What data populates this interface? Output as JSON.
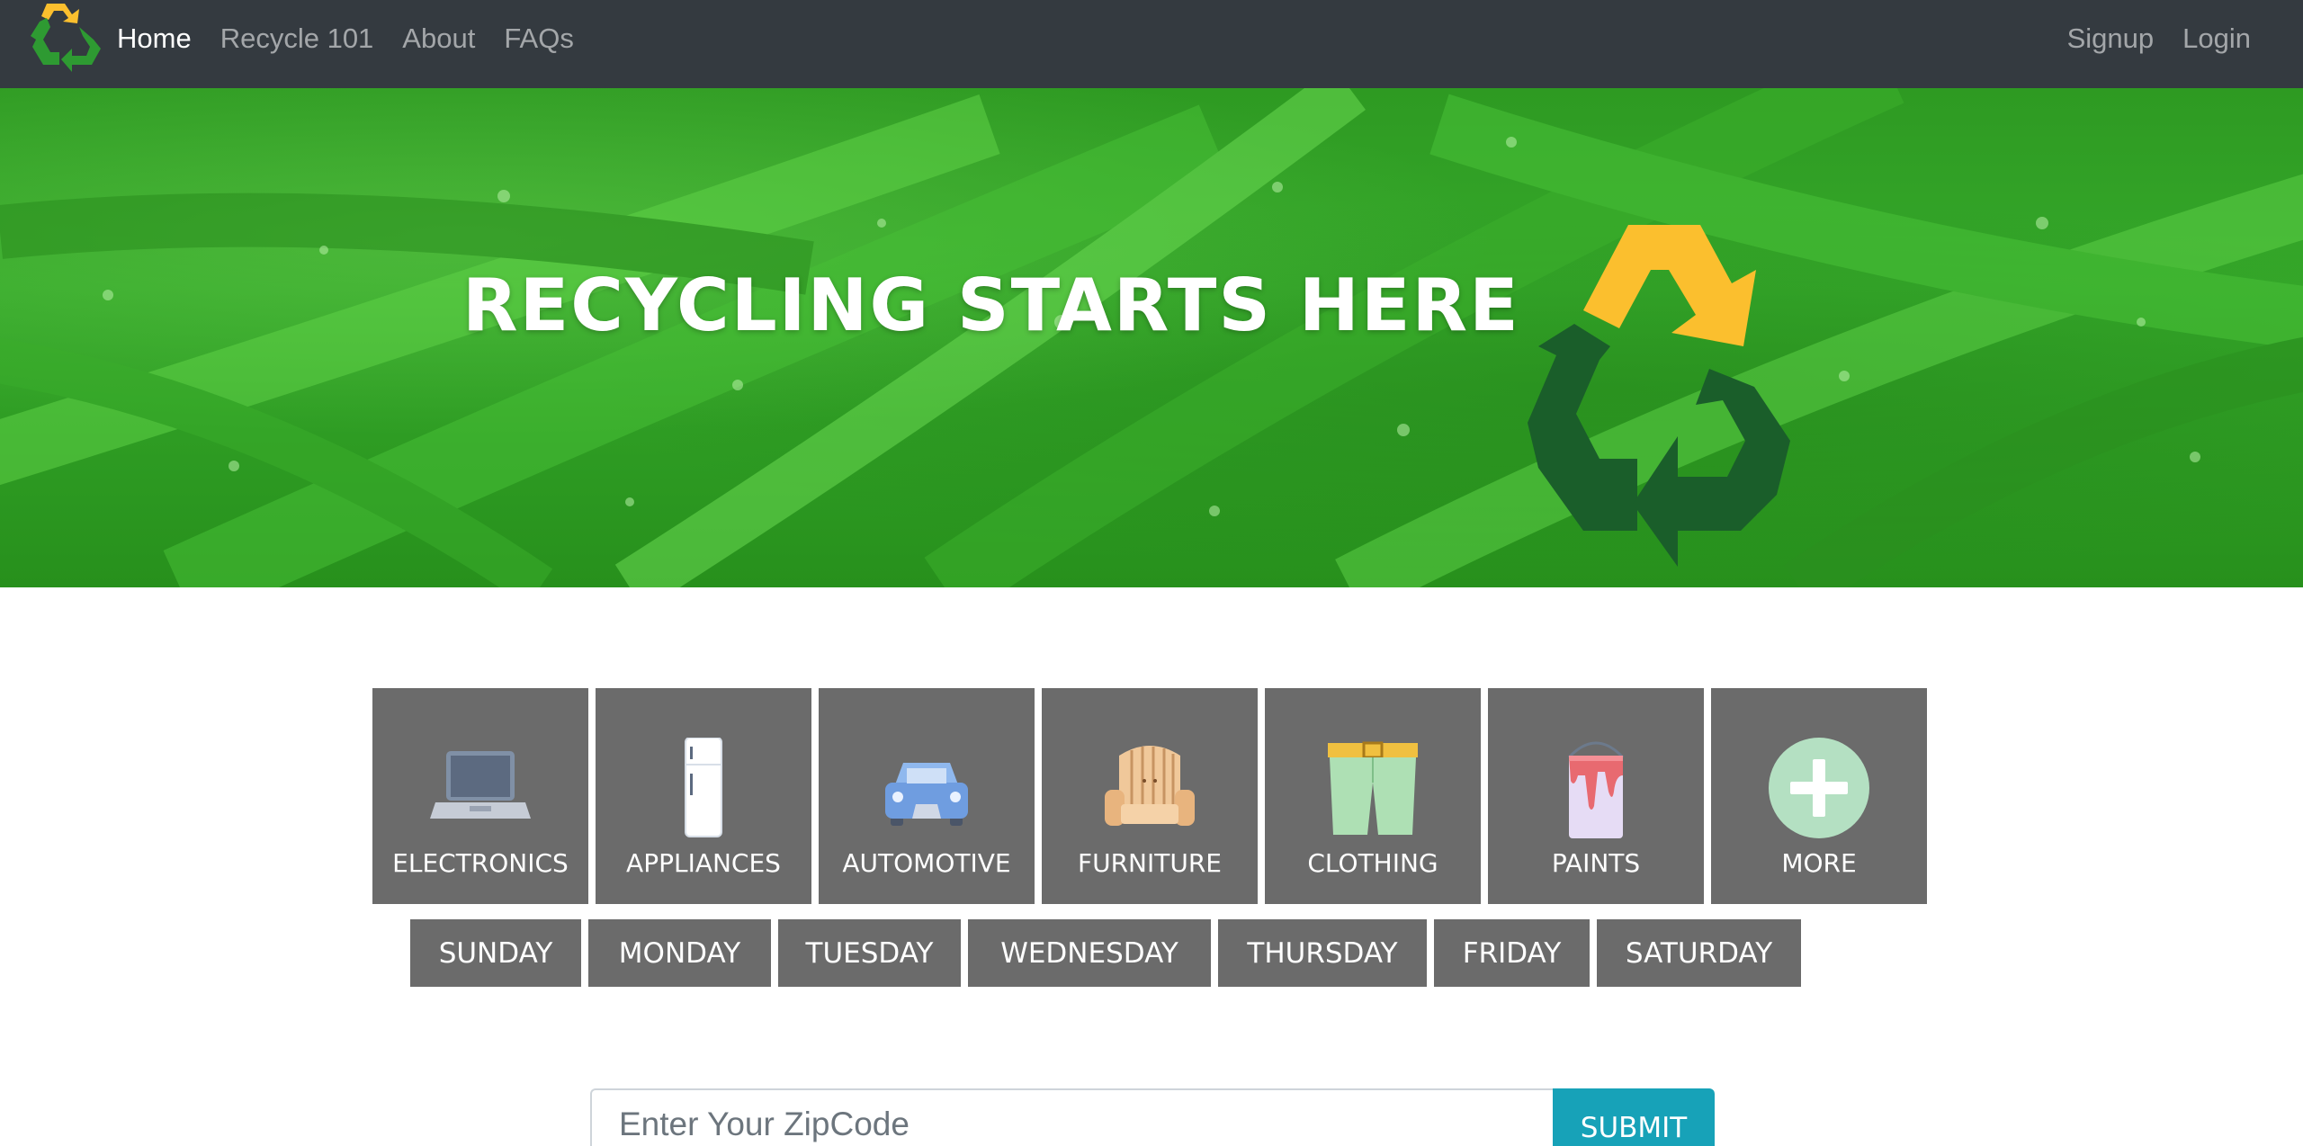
{
  "navbar": {
    "brand_icon": "recycle-logo-icon",
    "left_links": [
      {
        "label": "Home",
        "active": true
      },
      {
        "label": "Recycle 101",
        "active": false
      },
      {
        "label": "About",
        "active": false
      },
      {
        "label": "FAQs",
        "active": false
      }
    ],
    "right_links": [
      {
        "label": "Signup"
      },
      {
        "label": "Login"
      }
    ]
  },
  "hero": {
    "title": "RECYCLING STARTS HERE",
    "logo_icon": "recycle-logo-icon"
  },
  "categories": [
    {
      "label": "ELECTRONICS",
      "icon": "laptop-icon"
    },
    {
      "label": "APPLIANCES",
      "icon": "refrigerator-icon"
    },
    {
      "label": "AUTOMOTIVE",
      "icon": "car-icon"
    },
    {
      "label": "FURNITURE",
      "icon": "armchair-icon"
    },
    {
      "label": "CLOTHING",
      "icon": "shorts-icon"
    },
    {
      "label": "PAINTS",
      "icon": "paint-bucket-icon"
    },
    {
      "label": "MORE",
      "icon": "plus-circle-icon"
    }
  ],
  "days": [
    "SUNDAY",
    "MONDAY",
    "TUESDAY",
    "WEDNESDAY",
    "THURSDAY",
    "FRIDAY",
    "SATURDAY"
  ],
  "zip": {
    "placeholder": "Enter Your ZipCode",
    "value": "",
    "submit_label": "SUBMIT"
  },
  "colors": {
    "navbar": "#343a40",
    "tile": "#6b6b6b",
    "submit": "#17a2b8",
    "recycle_yellow": "#fbbf2e",
    "recycle_green": "#1a5e2a"
  }
}
